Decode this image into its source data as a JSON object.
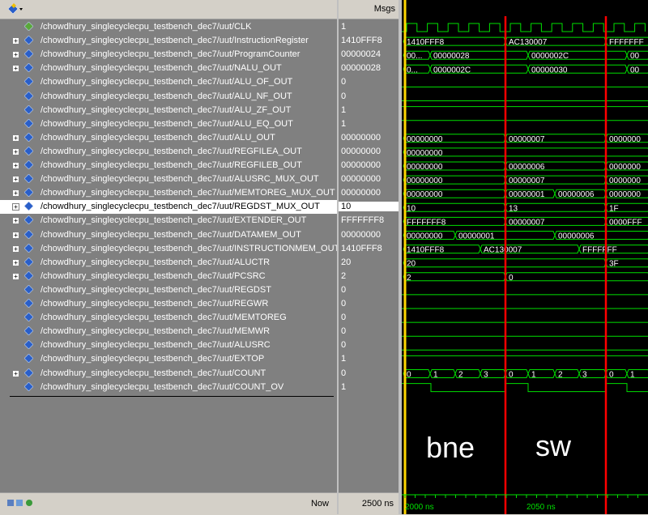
{
  "header": {
    "msgs_label": "Msgs"
  },
  "signals": [
    {
      "name": "/chowdhury_singlecyclecpu_testbench_dec7/uut/CLK",
      "value": "1",
      "expandable": false,
      "kind": "clk"
    },
    {
      "name": "/chowdhury_singlecyclecpu_testbench_dec7/uut/InstructionRegister",
      "value": "1410FFF8",
      "expandable": true
    },
    {
      "name": "/chowdhury_singlecyclecpu_testbench_dec7/uut/ProgramCounter",
      "value": "00000024",
      "expandable": true
    },
    {
      "name": "/chowdhury_singlecyclecpu_testbench_dec7/uut/NALU_OUT",
      "value": "00000028",
      "expandable": true
    },
    {
      "name": "/chowdhury_singlecyclecpu_testbench_dec7/uut/ALU_OF_OUT",
      "value": "0",
      "expandable": false
    },
    {
      "name": "/chowdhury_singlecyclecpu_testbench_dec7/uut/ALU_NF_OUT",
      "value": "0",
      "expandable": false
    },
    {
      "name": "/chowdhury_singlecyclecpu_testbench_dec7/uut/ALU_ZF_OUT",
      "value": "1",
      "expandable": false
    },
    {
      "name": "/chowdhury_singlecyclecpu_testbench_dec7/uut/ALU_EQ_OUT",
      "value": "1",
      "expandable": false
    },
    {
      "name": "/chowdhury_singlecyclecpu_testbench_dec7/uut/ALU_OUT",
      "value": "00000000",
      "expandable": true
    },
    {
      "name": "/chowdhury_singlecyclecpu_testbench_dec7/uut/REGFILEA_OUT",
      "value": "00000000",
      "expandable": true
    },
    {
      "name": "/chowdhury_singlecyclecpu_testbench_dec7/uut/REGFILEB_OUT",
      "value": "00000000",
      "expandable": true
    },
    {
      "name": "/chowdhury_singlecyclecpu_testbench_dec7/uut/ALUSRC_MUX_OUT",
      "value": "00000000",
      "expandable": true
    },
    {
      "name": "/chowdhury_singlecyclecpu_testbench_dec7/uut/MEMTOREG_MUX_OUT",
      "value": "00000000",
      "expandable": true
    },
    {
      "name": "/chowdhury_singlecyclecpu_testbench_dec7/uut/REGDST_MUX_OUT",
      "value": "10",
      "expandable": true,
      "selected": true
    },
    {
      "name": "/chowdhury_singlecyclecpu_testbench_dec7/uut/EXTENDER_OUT",
      "value": "FFFFFFF8",
      "expandable": true
    },
    {
      "name": "/chowdhury_singlecyclecpu_testbench_dec7/uut/DATAMEM_OUT",
      "value": "00000000",
      "expandable": true
    },
    {
      "name": "/chowdhury_singlecyclecpu_testbench_dec7/uut/INSTRUCTIONMEM_OUT",
      "value": "1410FFF8",
      "expandable": true
    },
    {
      "name": "/chowdhury_singlecyclecpu_testbench_dec7/uut/ALUCTR",
      "value": "20",
      "expandable": true
    },
    {
      "name": "/chowdhury_singlecyclecpu_testbench_dec7/uut/PCSRC",
      "value": "2",
      "expandable": true
    },
    {
      "name": "/chowdhury_singlecyclecpu_testbench_dec7/uut/REGDST",
      "value": "0",
      "expandable": false
    },
    {
      "name": "/chowdhury_singlecyclecpu_testbench_dec7/uut/REGWR",
      "value": "0",
      "expandable": false
    },
    {
      "name": "/chowdhury_singlecyclecpu_testbench_dec7/uut/MEMTOREG",
      "value": "0",
      "expandable": false
    },
    {
      "name": "/chowdhury_singlecyclecpu_testbench_dec7/uut/MEMWR",
      "value": "0",
      "expandable": false
    },
    {
      "name": "/chowdhury_singlecyclecpu_testbench_dec7/uut/ALUSRC",
      "value": "0",
      "expandable": false
    },
    {
      "name": "/chowdhury_singlecyclecpu_testbench_dec7/uut/EXTOP",
      "value": "1",
      "expandable": false
    },
    {
      "name": "/chowdhury_singlecyclecpu_testbench_dec7/uut/COUNT",
      "value": "0",
      "expandable": true
    },
    {
      "name": "/chowdhury_singlecyclecpu_testbench_dec7/uut/COUNT_OV",
      "value": "1",
      "expandable": false
    }
  ],
  "waves": {
    "InstructionRegister": [
      [
        "1410FFF8"
      ],
      [
        "AC130007"
      ],
      [
        "FFFFFFF"
      ]
    ],
    "ProgramCounter": [
      "00...",
      "00000028",
      "0000002C",
      "00"
    ],
    "NALU_OUT": [
      "0...",
      "0000002C",
      "00000030",
      "00"
    ],
    "ALU_OUT": [
      "00000000",
      "00000007",
      "0000000"
    ],
    "REGFILEA_OUT": [
      "00000000"
    ],
    "REGFILEB_OUT": [
      "00000000",
      "00000006",
      "0000000"
    ],
    "ALUSRC_MUX_OUT": [
      "00000000",
      "00000007",
      "0000000"
    ],
    "MEMTOREG_MUX_OUT": [
      "00000000",
      "00000001",
      "00000006",
      "0000000"
    ],
    "REGDST_MUX_OUT": [
      "10",
      "13",
      "1F"
    ],
    "EXTENDER_OUT": [
      "FFFFFFF8",
      "00000007",
      "0000FFF"
    ],
    "DATAMEM_OUT": [
      "00000000",
      "00000001",
      "00000006"
    ],
    "INSTRUCTIONMEM_OUT": [
      "1410FFF8",
      "AC130007",
      "FFFFFFF"
    ],
    "ALUCTR": [
      "20",
      "3F"
    ],
    "PCSRC": [
      "2",
      "0"
    ],
    "COUNT": [
      "0",
      "1",
      "2",
      "3",
      "0",
      "1",
      "2",
      "3",
      "0",
      "1"
    ]
  },
  "annotations": {
    "left": "bne",
    "right": "sw"
  },
  "footer": {
    "now_label": "Now",
    "now_value": "2500 ns",
    "time_left": "2000 ns",
    "time_right": "2050 ns"
  },
  "colors": {
    "wave_green": "#00e000",
    "cursor_yellow": "#ffd700",
    "marker_red": "#ff0000"
  }
}
